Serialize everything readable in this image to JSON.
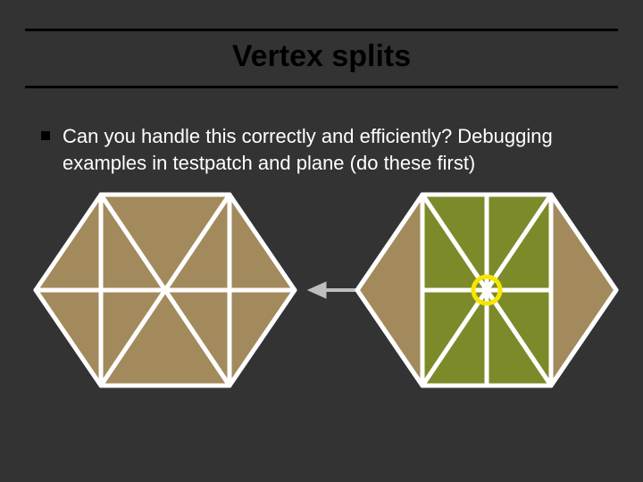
{
  "title": "Vertex splits",
  "bullet": "Can you handle this correctly and efficiently?  Debugging examples in testpatch and plane (do these first)",
  "colors": {
    "tri_brown": "#a38a5c",
    "tri_green": "#7c8a2a",
    "edge": "#ffffff",
    "arrow": "#cccccc",
    "highlight": "#f6e600"
  }
}
